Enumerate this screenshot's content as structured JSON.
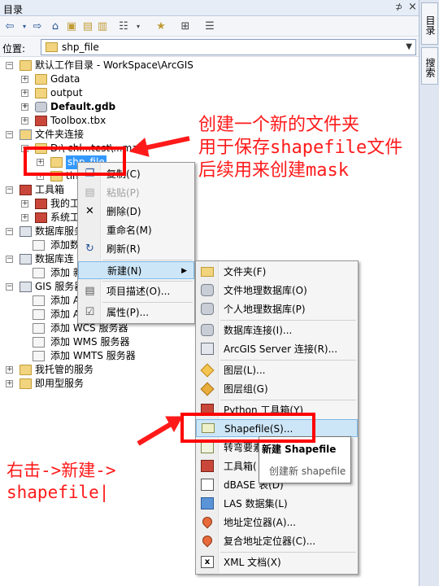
{
  "window": {
    "title": "目录",
    "pin": "⊅",
    "close": "×"
  },
  "side_tabs": [
    "目录",
    "搜索"
  ],
  "toolbar_icons": [
    "back-arrow-icon",
    "forward-arrow-icon",
    "home-icon",
    "up-folder-icon",
    "connect-folder-icon",
    "view-options-icon",
    "new-folder-icon",
    "tree-icon",
    "options-icon"
  ],
  "location": {
    "label": "位置:",
    "value": "shp_file"
  },
  "tree": {
    "root": "默认工作目录 - WorkSpace\\ArcGIS",
    "gdata": "Gdata",
    "output": "output",
    "default_gdb": "Default.gdb",
    "toolbox_tbx": "Toolbox.tbx",
    "folder_connections": "文件夹连接",
    "path": "D:\\ chl...test\\...mask",
    "shp_file": "shp_file",
    "tin": "tin",
    "toolbox": "工具箱",
    "my_toolbox": "我的工",
    "system_toolbox": "系统工",
    "db_servers": "数据库服务",
    "add_db": "添加数",
    "db_connections": "数据库连",
    "add_new": "添加 新",
    "gis_services": "GIS 服务器",
    "add_a1": "添加 A",
    "add_a2": "添加 A",
    "add_wcs": "添加 WCS 服务器",
    "add_wms": "添加 WMS 服务器",
    "add_wmts": "添加 WMTS 服务器",
    "hosted": "我托管的服务",
    "ready": "即用型服务"
  },
  "context_menu": {
    "copy": "复制(C)",
    "paste": "粘贴(P)",
    "delete": "删除(D)",
    "rename": "重命名(M)",
    "refresh": "刷新(R)",
    "new": "新建(N)",
    "description": "项目描述(O)...",
    "properties": "属性(P)..."
  },
  "new_submenu": {
    "folder": "文件夹(F)",
    "file_gdb": "文件地理数据库(O)",
    "personal_gdb": "个人地理数据库(P)",
    "db_connection": "数据库连接(I)...",
    "arcgis_server": "ArcGIS Server 连接(R)...",
    "layer": "图层(L)...",
    "group_layer": "图层组(G)",
    "python_toolbox": "Python 工具箱(Y)",
    "shapefile": "Shapefile(S)...",
    "turn_feature": "转弯要素类",
    "toolbox": "工具箱(",
    "dbase": "dBASE 表(D)",
    "las": "LAS 数据集(L)",
    "locator": "地址定位器(A)...",
    "composite_locator": "复合地址定位器(C)...",
    "xml": "XML 文档(X)"
  },
  "tooltip": {
    "title": "新建 Shapefile",
    "desc": "创建新 shapefile"
  },
  "annotations": {
    "top_line1": "创建一个新的文件夹",
    "top_line2": "用于保存shapefile文件",
    "top_line3": "后续用来创建mask",
    "bottom_line1": "右击->新建->",
    "bottom_line2": "shapefile|"
  },
  "colors": {
    "annotation": "#ff1a1a",
    "highlight": "#3399ff",
    "menu_hover": "#cde6f7"
  }
}
